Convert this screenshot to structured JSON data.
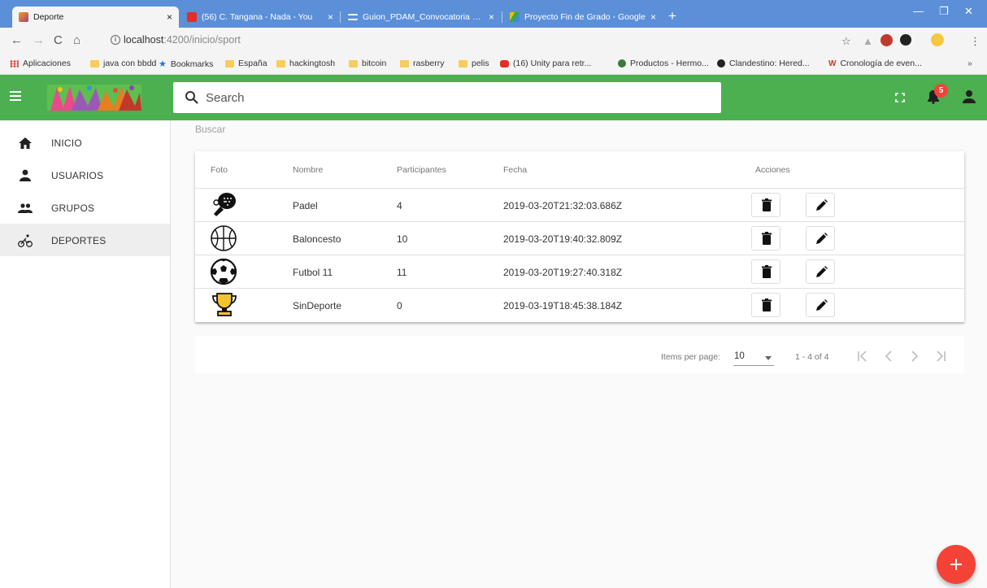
{
  "browser": {
    "tabs": [
      {
        "title": "Deporte",
        "active": true
      },
      {
        "title": "(56) C. Tangana - Nada - You"
      },
      {
        "title": "Guion_PDAM_Convocatoria Junio"
      },
      {
        "title": "Proyecto Fin de Grado - Google"
      }
    ],
    "tab_close": "×",
    "url_host": "localhost",
    "url_path": ":4200/inicio/sport",
    "bookmarks": [
      {
        "label": "Aplicaciones",
        "icon": "apps-icon"
      },
      {
        "label": "java con bbdd",
        "icon": "folder-icon"
      },
      {
        "label": "Bookmarks",
        "icon": "star-icon"
      },
      {
        "label": "España",
        "icon": "folder-icon"
      },
      {
        "label": "hackingtosh",
        "icon": "folder-icon"
      },
      {
        "label": "bitcoin",
        "icon": "folder-icon"
      },
      {
        "label": "rasberry",
        "icon": "folder-icon"
      },
      {
        "label": "pelis",
        "icon": "folder-icon"
      },
      {
        "label": "(16) Unity para retr...",
        "icon": "youtube-icon"
      },
      {
        "label": "Productos - Hermo...",
        "icon": "globe-icon"
      },
      {
        "label": "Clandestino: Hered...",
        "icon": "site-icon"
      },
      {
        "label": "Cronología de even...",
        "icon": "wiki-icon"
      }
    ],
    "more_bookmarks": "»"
  },
  "header": {
    "search_placeholder": "Search",
    "notifications_count": "5",
    "accent_color": "#4caf50"
  },
  "sidebar": {
    "items": [
      {
        "label": "INICIO",
        "icon": "home-icon"
      },
      {
        "label": "USUARIOS",
        "icon": "person-icon"
      },
      {
        "label": "GRUPOS",
        "icon": "group-icon"
      },
      {
        "label": "DEPORTES",
        "icon": "bike-icon",
        "active": true
      }
    ]
  },
  "main": {
    "filter_label": "Buscar",
    "columns": [
      "Foto",
      "Nombre",
      "Participantes",
      "Fecha",
      "Acciones"
    ],
    "rows": [
      {
        "icon": "padel-icon",
        "nombre": "Padel",
        "participantes": "4",
        "fecha": "2019-03-20T21:32:03.686Z"
      },
      {
        "icon": "basketball-icon",
        "nombre": "Baloncesto",
        "participantes": "10",
        "fecha": "2019-03-20T19:40:32.809Z"
      },
      {
        "icon": "soccer-ball-icon",
        "nombre": "Futbol 11",
        "participantes": "11",
        "fecha": "2019-03-20T19:27:40.318Z"
      },
      {
        "icon": "trophy-icon",
        "nombre": "SinDeporte",
        "participantes": "0",
        "fecha": "2019-03-19T18:45:38.184Z"
      }
    ],
    "paginator": {
      "items_per_page_label": "Items per page:",
      "page_size": "10",
      "range_label": "1 - 4 of 4"
    }
  }
}
